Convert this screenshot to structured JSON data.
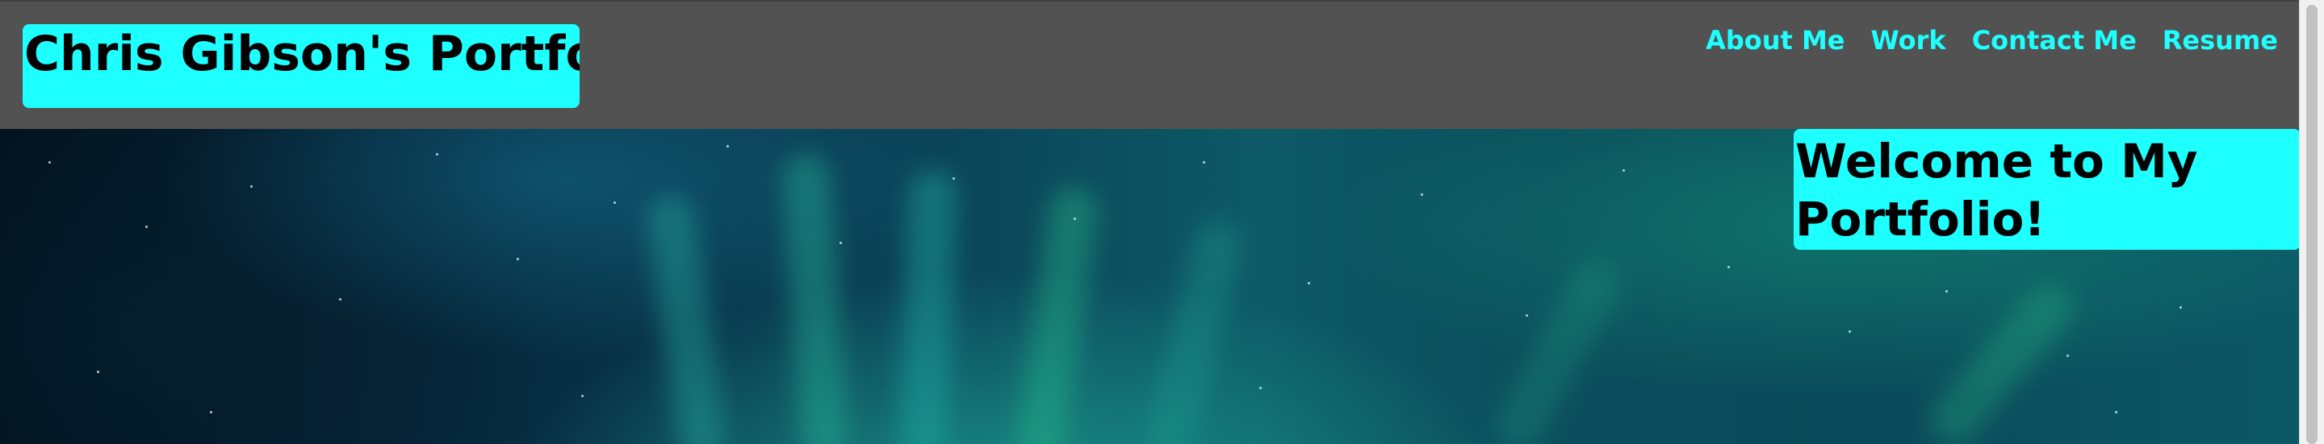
{
  "header": {
    "site_title": "Chris Gibson's Portfolio",
    "nav": [
      {
        "label": "About Me"
      },
      {
        "label": "Work"
      },
      {
        "label": "Contact Me"
      },
      {
        "label": "Resume"
      }
    ]
  },
  "hero": {
    "welcome": "Welcome to My Portfolio!",
    "background_image": "aurora-night-sky"
  },
  "colors": {
    "header_bg": "#525252",
    "accent": "#1effff",
    "text_dark": "#000000"
  }
}
